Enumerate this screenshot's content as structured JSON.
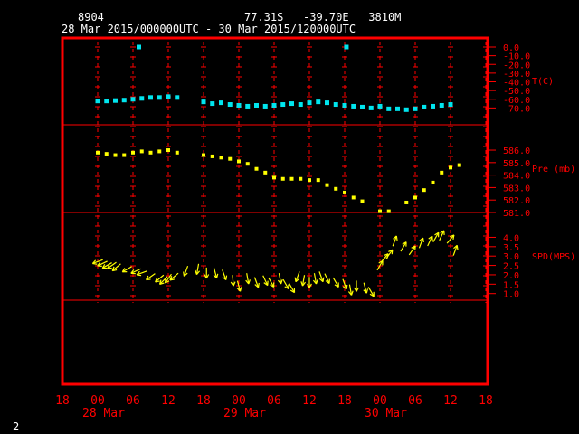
{
  "header": {
    "station": "8904",
    "location": "77.31S   -39.70E   3810M",
    "period": "28 Mar 2015/000000UTC - 30 Mar 2015/120000UTC"
  },
  "footer": {
    "page_number": "2"
  },
  "colors": {
    "background": "#000000",
    "frame": "#ff0000",
    "grid": "#ff0000",
    "labels": "#ff0000",
    "header_text": "#ffffff",
    "temperature": "#00e5ee",
    "pressure": "#ffff00",
    "wind": "#ffff00"
  },
  "x_axis": {
    "range_hours": [
      -6,
      54
    ],
    "ticks": [
      {
        "hour": -6,
        "label": "18"
      },
      {
        "hour": 0,
        "label": "00"
      },
      {
        "hour": 6,
        "label": "06"
      },
      {
        "hour": 12,
        "label": "12"
      },
      {
        "hour": 18,
        "label": "18"
      },
      {
        "hour": 24,
        "label": "00"
      },
      {
        "hour": 30,
        "label": "06"
      },
      {
        "hour": 36,
        "label": "12"
      },
      {
        "hour": 42,
        "label": "18"
      },
      {
        "hour": 48,
        "label": "00"
      },
      {
        "hour": 54,
        "label": "06"
      },
      {
        "hour": 60,
        "label": "12"
      },
      {
        "hour": 66,
        "label": "18"
      }
    ],
    "date_labels": [
      {
        "hour": 0,
        "label": "28 Mar"
      },
      {
        "hour": 24,
        "label": "29 Mar"
      },
      {
        "hour": 48,
        "label": "30 Mar"
      }
    ]
  },
  "chart_data": [
    {
      "type": "scatter",
      "ylabel": "T(C)",
      "ylim": [
        -80,
        0
      ],
      "yticks": [
        "0.0",
        "-10.0",
        "-20.0",
        "-30.0",
        "-40.0",
        "-50.0",
        "-60.0",
        "-70.0"
      ],
      "x_hours": [
        0,
        1.5,
        3,
        4.5,
        6,
        7.5,
        9,
        10.5,
        12,
        13.5,
        18,
        19.5,
        21,
        22.5,
        24,
        25.5,
        27,
        28.5,
        30,
        31.5,
        33,
        34.5,
        36,
        37.5,
        39,
        40.5,
        42,
        43.5,
        45,
        46.5,
        48,
        49.5,
        51,
        52.5,
        54,
        55.5,
        57,
        58.5,
        60
      ],
      "values": [
        -62,
        -62,
        -61.5,
        -61,
        -60,
        -59,
        -58,
        -58,
        -57,
        -58,
        -63,
        -65,
        -64,
        -66,
        -67,
        -68,
        -67,
        -68,
        -67,
        -66,
        -65,
        -66,
        -64,
        -63,
        -64,
        -66,
        -67,
        -68,
        -69,
        -70,
        -68,
        -71,
        -71,
        -72,
        -71,
        -69,
        -68,
        -67,
        -66
      ],
      "outliers": [
        {
          "hour": 7,
          "value": 0
        },
        {
          "hour": 42.3,
          "value": 0
        }
      ]
    },
    {
      "type": "scatter",
      "ylabel": "Pre (mb)",
      "ylim": [
        581,
        586.8
      ],
      "yticks": [
        "586.0",
        "585.0",
        "584.0",
        "583.0",
        "582.0",
        "581.0"
      ],
      "x_hours": [
        0,
        1.5,
        3,
        4.5,
        6,
        7.5,
        9,
        10.5,
        12,
        13.5,
        18,
        19.5,
        21,
        22.5,
        24,
        25.5,
        27,
        28.5,
        30,
        31.5,
        33,
        34.5,
        36,
        37.5,
        39,
        40.5,
        42,
        43.5,
        45,
        48,
        49.5,
        52.5,
        54,
        55.5,
        57,
        58.5,
        60,
        61.5
      ],
      "values": [
        585.8,
        585.7,
        585.6,
        585.6,
        585.8,
        585.9,
        585.8,
        585.9,
        586,
        585.8,
        585.6,
        585.5,
        585.4,
        585.3,
        585.1,
        584.9,
        584.5,
        584.2,
        583.8,
        583.7,
        583.7,
        583.7,
        583.6,
        583.6,
        583.2,
        582.9,
        582.6,
        582.2,
        581.9,
        581.1,
        581.1,
        581.8,
        582.2,
        582.8,
        583.4,
        584.2,
        584.6,
        584.8
      ]
    },
    {
      "type": "scatter",
      "ylabel": "SPD(MPS)",
      "ylim": [
        0.6,
        4.6
      ],
      "yticks": [
        "4.0",
        "3.5",
        "3.0",
        "2.5",
        "2.0",
        "1.5",
        "1.0"
      ],
      "x_hours": [
        0,
        0.8,
        1.6,
        2.4,
        3.2,
        5,
        6.5,
        7.5,
        9,
        10.5,
        11.2,
        12,
        13,
        15,
        17,
        18.5,
        20,
        21.5,
        23,
        24,
        25.5,
        27,
        28.5,
        29.5,
        31,
        32,
        33,
        34,
        35,
        36,
        37,
        38,
        39,
        40.5,
        42,
        43,
        44,
        45.5,
        46.5,
        48,
        48.8,
        49.6,
        50.5,
        52,
        53.5,
        55,
        56.5,
        57.5,
        58.5,
        60,
        60.8
      ],
      "values": [
        2.7,
        2.6,
        2.5,
        2.5,
        2.4,
        2.3,
        2.2,
        2.1,
        1.9,
        1.8,
        1.7,
        1.8,
        1.9,
        2.2,
        2.3,
        2.1,
        2.1,
        2.0,
        1.7,
        1.4,
        1.8,
        1.6,
        1.7,
        1.6,
        1.8,
        1.5,
        1.3,
        1.9,
        1.7,
        1.6,
        1.8,
        1.9,
        1.8,
        1.6,
        1.5,
        1.2,
        1.4,
        1.3,
        1.1,
        2.5,
        2.9,
        3.1,
        3.8,
        3.5,
        3.3,
        3.7,
        3.8,
        4.0,
        4.1,
        3.9,
        3.3
      ],
      "direction_deg": [
        250,
        245,
        240,
        235,
        230,
        240,
        245,
        250,
        235,
        230,
        225,
        215,
        230,
        200,
        190,
        180,
        165,
        160,
        175,
        165,
        170,
        160,
        155,
        150,
        170,
        150,
        150,
        200,
        190,
        180,
        170,
        160,
        155,
        150,
        160,
        170,
        180,
        165,
        150,
        30,
        40,
        35,
        20,
        30,
        35,
        20,
        25,
        30,
        25,
        40,
        20
      ]
    }
  ]
}
